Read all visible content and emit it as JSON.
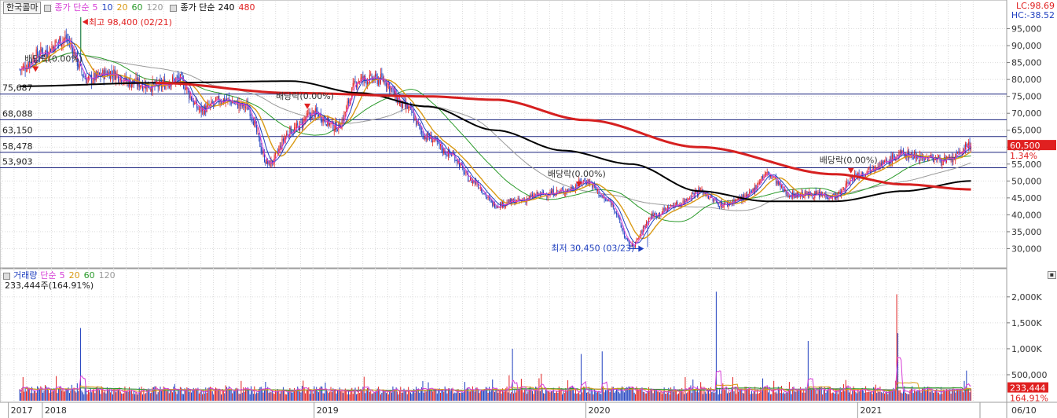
{
  "legend_price": {
    "stock_name": "한국콜마",
    "group1_label": "종가 단순",
    "group1_periods": [
      {
        "p": "5",
        "color": "#d63dd6"
      },
      {
        "p": "10",
        "color": "#1f3fbf"
      },
      {
        "p": "20",
        "color": "#d99a14"
      },
      {
        "p": "60",
        "color": "#2a9a2a"
      },
      {
        "p": "120",
        "color": "#9a9a9a"
      }
    ],
    "group2_label": "종가 단순",
    "group2_periods": [
      {
        "p": "240",
        "color": "#000000"
      },
      {
        "p": "480",
        "color": "#e02020"
      }
    ]
  },
  "legend_volume": {
    "label": "거래량",
    "ma_label": "단순",
    "periods": [
      {
        "p": "5",
        "color": "#d63dd6"
      },
      {
        "p": "20",
        "color": "#d99a14"
      },
      {
        "p": "60",
        "color": "#2a9a2a"
      },
      {
        "p": "120",
        "color": "#9a9a9a"
      }
    ],
    "current": "233,444주(164.91%)"
  },
  "readout": {
    "lc": "LC:98.69",
    "hc": "HC:-38.52",
    "lc_color": "#e02020",
    "hc_color": "#1f3fbf"
  },
  "colors": {
    "up": "#e02020",
    "down": "#1f3fbf",
    "ma5": "#d63dd6",
    "ma10": "#1f3fbf",
    "ma20": "#d99a14",
    "ma60": "#2a9a2a",
    "ma120": "#9a9a9a",
    "ma240": "#000000",
    "ma480": "#d62020",
    "hline": "#1a237e"
  },
  "chart_data": {
    "type": "candlestick",
    "price_axis": {
      "min": 25000,
      "max": 100000,
      "ticks": [
        "30,000",
        "35,000",
        "40,000",
        "45,000",
        "50,000",
        "55,000",
        "60,000",
        "65,000",
        "70,000",
        "75,000",
        "80,000",
        "85,000",
        "90,000",
        "95,000"
      ]
    },
    "volume_axis": {
      "min": 0,
      "max": 2300000,
      "ticks": [
        {
          "v": 500000,
          "label": "500,000"
        },
        {
          "v": 1000000,
          "label": "1,000K"
        },
        {
          "v": 1500000,
          "label": "1,500K"
        },
        {
          "v": 2000000,
          "label": "2,000K"
        }
      ]
    },
    "x_axis": {
      "labels": [
        "2017",
        "2018",
        "2019",
        "2020",
        "2021",
        "06/10"
      ]
    },
    "horizontal_lines": [
      {
        "value": 75687,
        "label": "75,687"
      },
      {
        "value": 68088,
        "label": "68,088"
      },
      {
        "value": 63150,
        "label": "63,150"
      },
      {
        "value": 58478,
        "label": "58,478"
      },
      {
        "value": 53903,
        "label": "53,903"
      }
    ],
    "price_path": [
      [
        "2017-12",
        "83000"
      ],
      [
        "2018-01",
        "88000"
      ],
      [
        "2018-02",
        "92000"
      ],
      [
        "2018-03",
        "80000"
      ],
      [
        "2018-04",
        "82000"
      ],
      [
        "2018-05",
        "79000"
      ],
      [
        "2018-06",
        "78000"
      ],
      [
        "2018-07",
        "80000"
      ],
      [
        "2018-08",
        "71000"
      ],
      [
        "2018-09",
        "74000"
      ],
      [
        "2018-10",
        "72000"
      ],
      [
        "2018-11",
        "55000"
      ],
      [
        "2018-12",
        "65000"
      ],
      [
        "2019-01",
        "70000"
      ],
      [
        "2019-02",
        "66000"
      ],
      [
        "2019-03",
        "80000"
      ],
      [
        "2019-04",
        "80000"
      ],
      [
        "2019-05",
        "72000"
      ],
      [
        "2019-06",
        "63000"
      ],
      [
        "2019-07",
        "58000"
      ],
      [
        "2019-08",
        "50000"
      ],
      [
        "2019-09",
        "43000"
      ],
      [
        "2019-10",
        "44000"
      ],
      [
        "2019-11",
        "46000"
      ],
      [
        "2019-12",
        "47000"
      ],
      [
        "2020-01",
        "50000"
      ],
      [
        "2020-02",
        "44000"
      ],
      [
        "2020-03",
        "31000"
      ],
      [
        "2020-04",
        "40000"
      ],
      [
        "2020-05",
        "43000"
      ],
      [
        "2020-06",
        "47000"
      ],
      [
        "2020-07",
        "43000"
      ],
      [
        "2020-08",
        "45000"
      ],
      [
        "2020-09",
        "52000"
      ],
      [
        "2020-10",
        "46000"
      ],
      [
        "2020-11",
        "46000"
      ],
      [
        "2020-12",
        "45500"
      ],
      [
        "2021-01",
        "52000"
      ],
      [
        "2021-02",
        "55000"
      ],
      [
        "2021-03",
        "58000"
      ],
      [
        "2021-04",
        "57000"
      ],
      [
        "2021-05",
        "56000"
      ],
      [
        "2021-06",
        "60500"
      ]
    ],
    "ma240_path": [
      [
        "2017-12",
        "78000"
      ],
      [
        "2018-06",
        "79000"
      ],
      [
        "2018-12",
        "79500"
      ],
      [
        "2019-03",
        "76000"
      ],
      [
        "2019-06",
        "72000"
      ],
      [
        "2019-09",
        "65000"
      ],
      [
        "2019-12",
        "59000"
      ],
      [
        "2020-03",
        "55000"
      ],
      [
        "2020-06",
        "47000"
      ],
      [
        "2020-09",
        "44000"
      ],
      [
        "2020-12",
        "44000"
      ],
      [
        "2021-03",
        "47000"
      ],
      [
        "2021-06",
        "50000"
      ]
    ],
    "ma480_path": [
      [
        "2018-06",
        "79000"
      ],
      [
        "2018-12",
        "76000"
      ],
      [
        "2019-06",
        "75000"
      ],
      [
        "2019-09",
        "74000"
      ],
      [
        "2020-01",
        "68000"
      ],
      [
        "2020-06",
        "60000"
      ],
      [
        "2020-12",
        "52000"
      ],
      [
        "2021-03",
        "49000"
      ],
      [
        "2021-06",
        "47500"
      ]
    ],
    "annotations": [
      {
        "text": "최고 98,400 (02/21)",
        "date": "2018-02",
        "value": 98400,
        "kind": "high"
      },
      {
        "text": "최저 30,450 (03/23)",
        "date": "2020-03",
        "value": 30450,
        "kind": "low"
      },
      {
        "text": "배당락(0.00%)",
        "date": "2017-12",
        "value": 82000,
        "kind": "div"
      },
      {
        "text": "배당락(0.00%)",
        "date": "2018-12",
        "value": 71000,
        "kind": "div"
      },
      {
        "text": "배당락(0.00%)",
        "date": "2019-12",
        "value": 48000,
        "kind": "div"
      },
      {
        "text": "배당락(0.00%)",
        "date": "2020-12",
        "value": 52000,
        "kind": "div"
      }
    ],
    "last_price": {
      "value": 60500,
      "label": "60,500",
      "change": "1.34%"
    },
    "last_volume": {
      "value": 233444,
      "label": "233,444",
      "change": "164.91%"
    },
    "volume_spikes": [
      {
        "date": "2018-02",
        "value": 1400000
      },
      {
        "date": "2019-09",
        "value": 1000000
      },
      {
        "date": "2019-12",
        "value": 900000
      },
      {
        "date": "2020-01",
        "value": 950000
      },
      {
        "date": "2020-06",
        "value": 2100000
      },
      {
        "date": "2020-10",
        "value": 1150000
      },
      {
        "date": "2021-02",
        "value": 2050000
      },
      {
        "date": "2021-02",
        "value": 1300000
      },
      {
        "date": "2021-05",
        "value": 580000
      }
    ]
  }
}
